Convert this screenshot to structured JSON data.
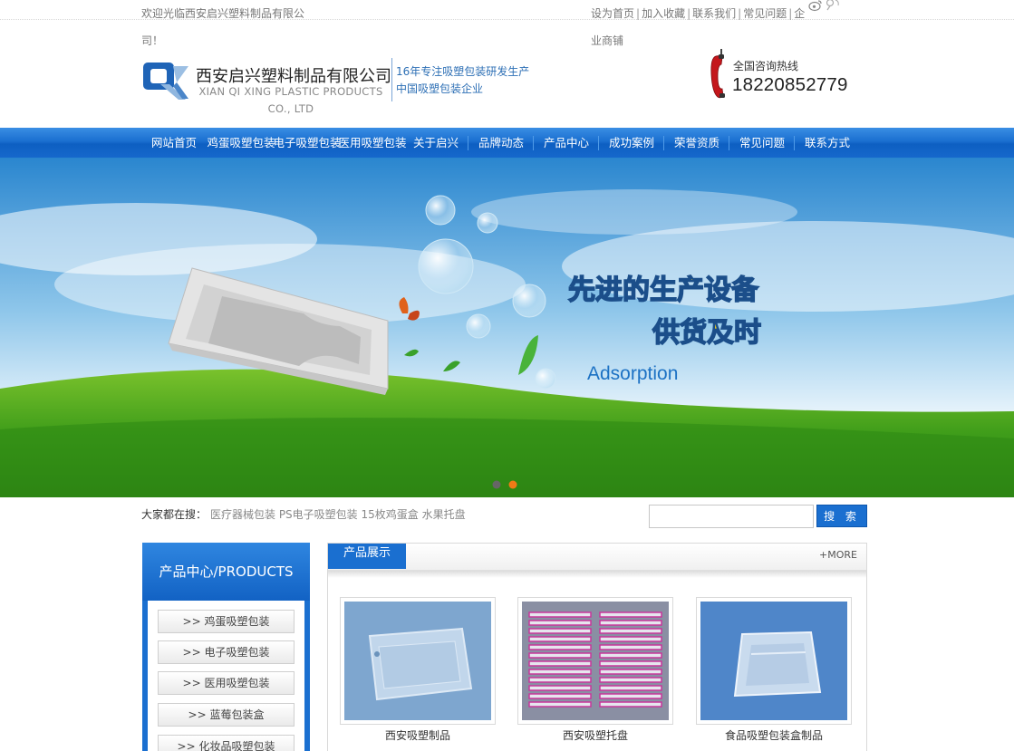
{
  "topbar": {
    "welcome": "欢迎光临西安启兴塑料制品有限公司！",
    "links": [
      "设为首页",
      "加入收藏",
      "联系我们",
      "常见问题",
      "企业商铺"
    ]
  },
  "header": {
    "company_cn": "西安启兴塑料制品有限公司",
    "company_en": "XIAN QI XING PLASTIC PRODUCTS CO., LTD",
    "slogan_1": "16年专注吸塑包装研发生产",
    "slogan_2": "中国吸塑包装企业",
    "hotline_label": "全国咨询热线",
    "hotline_number": "18220852779"
  },
  "nav": [
    "网站首页",
    "鸡蛋吸塑包装",
    "电子吸塑包装",
    "医用吸塑包装",
    "关于启兴",
    "品牌动态",
    "产品中心",
    "成功案例",
    "荣誉资质",
    "常见问题",
    "联系方式"
  ],
  "banner": {
    "headline_1": "先进的生产设备",
    "headline_2": "供货及时",
    "tagline": "Adsorption"
  },
  "search": {
    "label": "大家都在搜：",
    "keywords": "医疗器械包装 PS电子吸塑包装 15枚鸡蛋盒 水果托盘",
    "button": "搜 索"
  },
  "sidebar": {
    "title": "产品中心/PRODUCTS",
    "items": [
      ">> 鸡蛋吸塑包装",
      ">> 电子吸塑包装",
      ">> 医用吸塑包装",
      ">> 蓝莓包装盒",
      ">> 化妆品吸塑包装"
    ]
  },
  "products": {
    "tab": "产品展示",
    "more": "+MORE",
    "items": [
      "西安吸塑制品",
      "西安吸塑托盘",
      "食品吸塑包装盒制品"
    ]
  },
  "colors": {
    "brand_blue": "#1a6fd0",
    "accent_text": "#2d6fb5"
  }
}
